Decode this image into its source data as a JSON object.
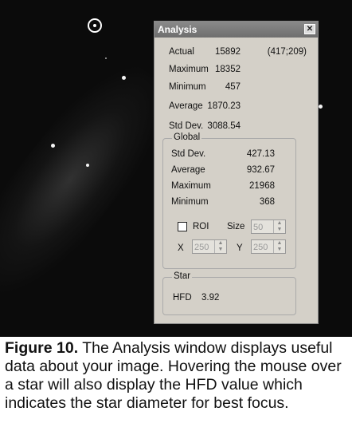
{
  "window": {
    "title": "Analysis",
    "close_glyph": "✕",
    "stats": [
      {
        "label": "Actual",
        "value": "15892",
        "extra": "(417;209)"
      },
      {
        "label": "Maximum",
        "value": "18352"
      },
      {
        "label": "Minimum",
        "value": "457"
      },
      {
        "label": "Average",
        "value": "1870.23"
      },
      {
        "label": "Std Dev.",
        "value": "3088.54"
      }
    ],
    "global": {
      "legend": "Global",
      "rows": [
        {
          "label": "Std Dev.",
          "value": "427.13"
        },
        {
          "label": "Average",
          "value": "932.67"
        },
        {
          "label": "Maximum",
          "value": "21968"
        },
        {
          "label": "Minimum",
          "value": "368"
        }
      ],
      "roi_label": "ROI",
      "size_label": "Size",
      "size_value": "50",
      "x_label": "X",
      "x_value": "250",
      "y_label": "Y",
      "y_value": "250"
    },
    "star": {
      "legend": "Star",
      "hfd_label": "HFD",
      "hfd_value": "3.92"
    }
  },
  "caption": {
    "figure": "Figure 10.",
    "text": " The Analysis window displays useful data about your image. Hovering the mouse over a star will also display the HFD value which indicates the star diameter for best focus."
  }
}
